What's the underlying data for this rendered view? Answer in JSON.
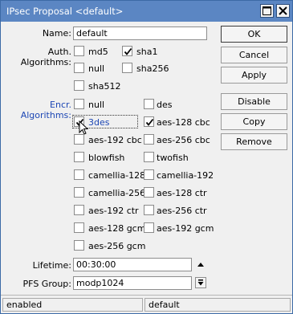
{
  "window": {
    "title": "IPsec Proposal <default>"
  },
  "form": {
    "name_label": "Name:",
    "name_value": "default",
    "auth_label": "Auth. Algorithms:",
    "auth": [
      {
        "label": "md5",
        "checked": false
      },
      {
        "label": "sha1",
        "checked": true
      },
      {
        "label": "null",
        "checked": false
      },
      {
        "label": "sha256",
        "checked": false
      },
      {
        "label": "sha512",
        "checked": false
      }
    ],
    "encr_label": "Encr. Algorithms:",
    "encr": [
      {
        "label": "null",
        "checked": false
      },
      {
        "label": "des",
        "checked": false
      },
      {
        "label": "3des",
        "checked": true
      },
      {
        "label": "aes-128 cbc",
        "checked": true
      },
      {
        "label": "aes-192 cbc",
        "checked": false
      },
      {
        "label": "aes-256 cbc",
        "checked": false
      },
      {
        "label": "blowfish",
        "checked": false
      },
      {
        "label": "twofish",
        "checked": false
      },
      {
        "label": "camellia-128",
        "checked": false
      },
      {
        "label": "camellia-192",
        "checked": false
      },
      {
        "label": "camellia-256",
        "checked": false
      },
      {
        "label": "aes-128 ctr",
        "checked": false
      },
      {
        "label": "aes-192 ctr",
        "checked": false
      },
      {
        "label": "aes-256 ctr",
        "checked": false
      },
      {
        "label": "aes-128 gcm",
        "checked": false
      },
      {
        "label": "aes-192 gcm",
        "checked": false
      },
      {
        "label": "aes-256 gcm",
        "checked": false
      }
    ],
    "lifetime_label": "Lifetime:",
    "lifetime_value": "00:30:00",
    "pfs_label": "PFS Group:",
    "pfs_value": "modp1024"
  },
  "buttons": {
    "ok": "OK",
    "cancel": "Cancel",
    "apply": "Apply",
    "disable": "Disable",
    "copy": "Copy",
    "remove": "Remove"
  },
  "status": {
    "left": "enabled",
    "right": "default"
  },
  "colors": {
    "titlebar": "#5b86c3",
    "encr_label": "#1c46b4",
    "focused_text": "#1c46b4"
  }
}
